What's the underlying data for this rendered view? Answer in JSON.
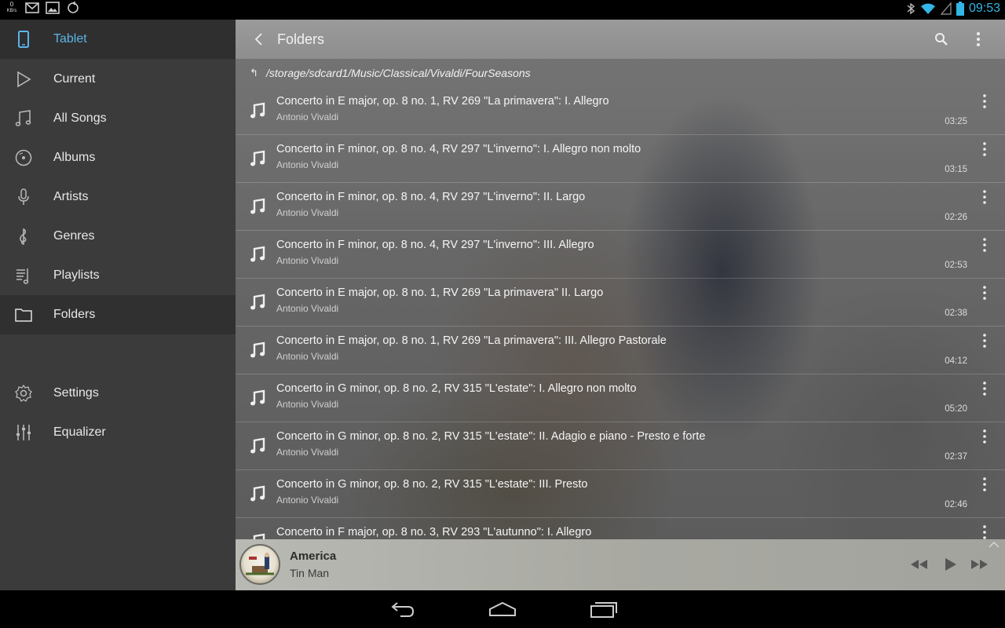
{
  "status_bar": {
    "speed_value": "0",
    "speed_unit": "KB/s",
    "clock": "09:53",
    "icons": [
      "mail-icon",
      "image-icon",
      "sync-icon",
      "bluetooth-icon",
      "wifi-icon",
      "signal-icon",
      "battery-icon"
    ]
  },
  "sidebar": {
    "header": {
      "label": "Tablet",
      "icon": "tablet-icon"
    },
    "items": [
      {
        "label": "Current",
        "icon": "play-outline-icon"
      },
      {
        "label": "All Songs",
        "icon": "music-notes-icon"
      },
      {
        "label": "Albums",
        "icon": "disc-icon"
      },
      {
        "label": "Artists",
        "icon": "microphone-icon"
      },
      {
        "label": "Genres",
        "icon": "treble-clef-icon"
      },
      {
        "label": "Playlists",
        "icon": "playlist-icon"
      },
      {
        "label": "Folders",
        "icon": "folder-icon",
        "active": true
      }
    ],
    "bottom_items": [
      {
        "label": "Settings",
        "icon": "gear-icon"
      },
      {
        "label": "Equalizer",
        "icon": "equalizer-icon"
      }
    ]
  },
  "toolbar": {
    "title": "Folders",
    "back_icon": "back-arrow-icon",
    "search_icon": "search-icon",
    "menu_icon": "overflow-menu-icon"
  },
  "path": {
    "up_glyph": "↰",
    "text": "/storage/sdcard1/Music/Classical/Vivaldi/FourSeasons"
  },
  "songs": [
    {
      "title": "Concerto in E major, op. 8 no. 1, RV 269 \"La primavera\": I. Allegro",
      "artist": "Antonio Vivaldi",
      "duration": "03:25"
    },
    {
      "title": "Concerto in F minor, op. 8 no. 4, RV 297 \"L'inverno\": I. Allegro non molto",
      "artist": "Antonio Vivaldi",
      "duration": "03:15"
    },
    {
      "title": "Concerto in F minor, op. 8 no. 4, RV 297 \"L'inverno\": II. Largo",
      "artist": "Antonio Vivaldi",
      "duration": "02:26"
    },
    {
      "title": "Concerto in F minor, op. 8 no. 4, RV 297 \"L'inverno\": III. Allegro",
      "artist": "Antonio Vivaldi",
      "duration": "02:53"
    },
    {
      "title": "Concerto in E major, op. 8 no. 1, RV 269 \"La primavera\" II. Largo",
      "artist": "Antonio Vivaldi",
      "duration": "02:38"
    },
    {
      "title": "Concerto in E major, op. 8 no. 1, RV 269 \"La primavera\": III. Allegro Pastorale",
      "artist": "Antonio Vivaldi",
      "duration": "04:12"
    },
    {
      "title": "Concerto in G minor, op. 8 no. 2, RV 315 \"L'estate\": I. Allegro non molto",
      "artist": "Antonio Vivaldi",
      "duration": "05:20"
    },
    {
      "title": "Concerto in G minor, op. 8 no. 2, RV 315 \"L'estate\": II. Adagio e piano - Presto e forte",
      "artist": "Antonio Vivaldi",
      "duration": "02:37"
    },
    {
      "title": "Concerto in G minor, op. 8 no. 2, RV 315 \"L'estate\": III. Presto",
      "artist": "Antonio Vivaldi",
      "duration": "02:46"
    },
    {
      "title": "Concerto in F major, op. 8 no. 3, RV 293 \"L'autunno\": I. Allegro",
      "artist": "",
      "duration": ""
    }
  ],
  "now_playing": {
    "title": "America",
    "artist": "Tin Man"
  },
  "colors": {
    "accent": "#33b5e5",
    "sidebar_bg": "#3b3b3b",
    "toolbar_bg": "#8e8e8e"
  }
}
